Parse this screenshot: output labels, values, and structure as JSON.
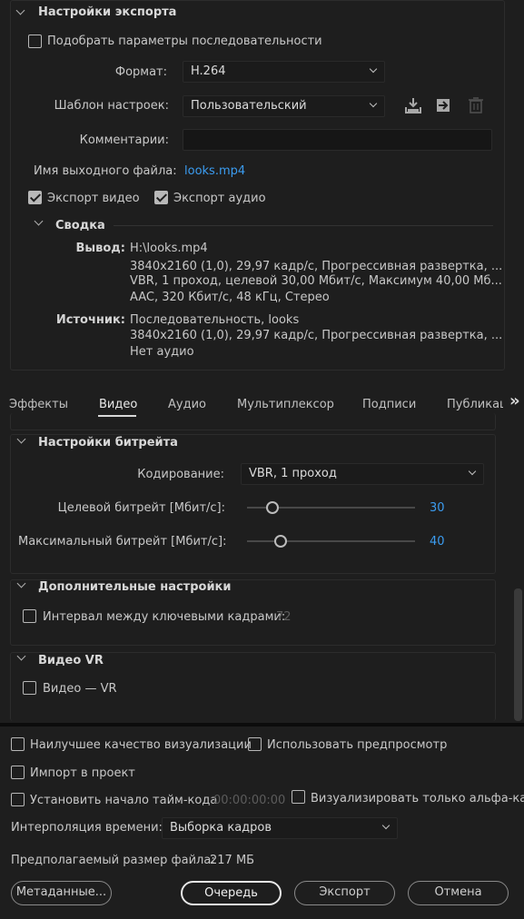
{
  "export_settings": {
    "title": "Настройки экспорта",
    "match_sequence_label": "Подобрать параметры последовательности",
    "format_label": "Формат:",
    "format_value": "H.264",
    "preset_label": "Шаблон настроек:",
    "preset_value": "Пользовательский",
    "comments_label": "Комментарии:",
    "comments_value": "",
    "output_name_label": "Имя выходного файла:",
    "output_name_value": "looks.mp4",
    "export_video_label": "Экспорт видео",
    "export_video_checked": true,
    "export_audio_label": "Экспорт аудио",
    "export_audio_checked": true
  },
  "summary": {
    "title": "Сводка",
    "output_label": "Вывод:",
    "output_lines": [
      "H:\\looks.mp4",
      "3840x2160 (1,0), 29,97 кадр/с, Прогрессивная развертка, ...",
      "VBR, 1 проход, целевой 30,00 Мбит/с, Максимум 40,00 Мб...",
      "AAC, 320 Кбит/с, 48 кГц, Стерео"
    ],
    "source_label": "Источник:",
    "source_lines": [
      "Последовательность, looks",
      "3840x2160 (1,0), 29,97 кадр/с, Прогрессивная развертка, ...",
      "Нет аудио"
    ]
  },
  "tabs": [
    "Эффекты",
    "Видео",
    "Аудио",
    "Мультиплексор",
    "Подписи",
    "Публикац"
  ],
  "tabs_more_glyph": "»",
  "active_tab": "Видео",
  "bitrate": {
    "title": "Настройки битрейта",
    "encoding_label": "Кодирование:",
    "encoding_value": "VBR, 1 проход",
    "target_label": "Целевой битрейт [Мбит/с]:",
    "target_value": "30",
    "target_fraction": 0.15,
    "max_label": "Максимальный битрейт [Мбит/с]:",
    "max_value": "40",
    "max_fraction": 0.2
  },
  "advanced": {
    "title": "Дополнительные настройки",
    "keyframe_label": "Интервал между ключевыми кадрами:",
    "keyframe_value": "72"
  },
  "vr": {
    "title": "Видео VR",
    "vr_label": "Видео — VR"
  },
  "bottom": {
    "max_render_quality": "Наилучшее качество визуализации",
    "use_previews": "Использовать предпросмотр",
    "import_into_project": "Импорт в проект",
    "set_start_timecode": "Установить начало тайм-кода",
    "timecode_value": "00:00:00:00",
    "render_alpha_only": "Визуализировать только альфа-кана",
    "time_interp_label": "Интерполяция времени:",
    "time_interp_value": "Выборка кадров",
    "file_size_label": "Предполагаемый размер файла:",
    "file_size_value": "217 МБ",
    "metadata_button": "Метаданные...",
    "queue_button": "Очередь",
    "export_button": "Экспорт",
    "cancel_button": "Отмена"
  },
  "colors": {
    "background": "#1e1e1e",
    "link": "#3b9cf0",
    "text": "#c8c8c8"
  }
}
